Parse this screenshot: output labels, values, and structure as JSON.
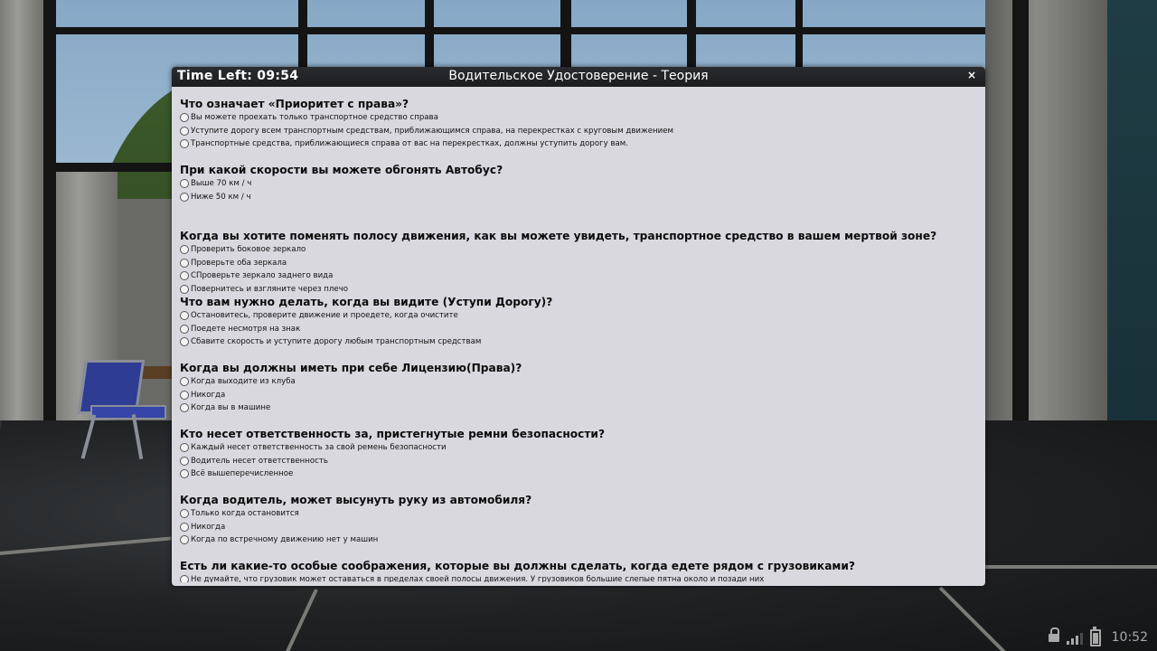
{
  "window": {
    "timer": "Time Left: 09:54",
    "title": "Водительское Удостоверение - Теория",
    "close_label": "×"
  },
  "questions": [
    {
      "text": "Что означает «Приоритет с права»?",
      "options": [
        "Вы можете проехать только транспортное средство справа",
        "Уступите дорогу всем транспортным средствам, приближающимся справа, на перекрестках с круговым движением",
        "Транспортные средства, приближающиеся справа от вас на перекрестках, должны уступить дорогу вам."
      ]
    },
    {
      "text": "При какой скорости вы можете обгонять Автобус?",
      "options": [
        "Выше 70 км / ч",
        "Ниже 50 км / ч"
      ]
    },
    {
      "text": "Когда вы хотите поменять полосу движения, как вы можете увидеть, транспортное средство в вашем мертвой зоне?",
      "options": [
        "Проверить боковое зеркало",
        "Проверьте оба зеркала",
        "СПроверьте зеркало заднего вида",
        "Повернитесь и взгляните через плечо"
      ]
    },
    {
      "text": "Что вам нужно делать, когда вы видите (Уступи Дорогу)?",
      "options": [
        "Остановитесь, проверите движение и проедете, когда очистите",
        "Поедете несмотря на знак",
        "Сбавите скорость и уступите дорогу любым транспортным средствам"
      ]
    },
    {
      "text": "Когда вы должны иметь при себе Лицензию(Права)?",
      "options": [
        "Когда выходите из клуба",
        "Никогда",
        "Когда вы в машине"
      ]
    },
    {
      "text": "Кто несет ответственность за, пристегнутые ремни безопасности?",
      "options": [
        "Каждый несет ответственность за свой ремень безопасности",
        "Водитель несет ответственность",
        "Всё вышеперечисленное"
      ]
    },
    {
      "text": "Когда водитель, может высунуть руку из автомобиля?",
      "options": [
        "Только когда остановится",
        "Никогда",
        "Когда по встречному движению нет у машин"
      ]
    },
    {
      "text": "Есть ли какие-то особые соображения, которые вы должны сделать, когда едете рядом с грузовиками?",
      "options": [
        "Не думайте, что грузовик может оставаться в пределах своей полосы движения. У грузовиков большие слепые пятна около и позади них"
      ]
    }
  ],
  "hud": {
    "clock": "10:52",
    "icons": [
      "lock-icon",
      "signal-icon",
      "battery-icon"
    ],
    "signal_level": 0.75,
    "battery_level": 0.8
  },
  "colors": {
    "dialog_bg": "#d9d8de",
    "titlebar_bg": "#1c1d1f",
    "hud_gray": "#a9a9a9"
  }
}
